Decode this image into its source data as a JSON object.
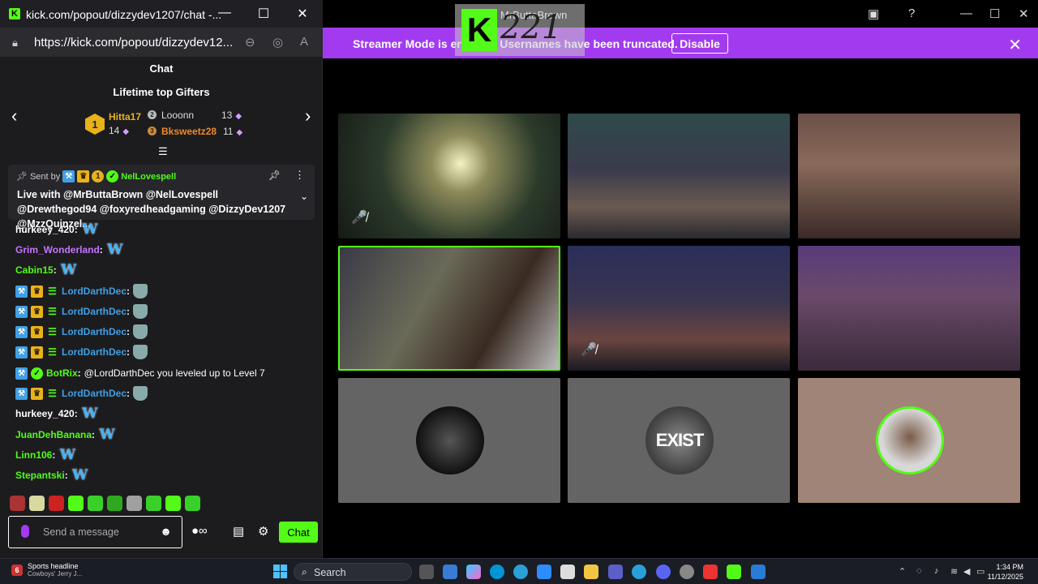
{
  "window": {
    "title": "kick.com/popout/dizzydev1207/chat -...",
    "url": "https://kick.com/popout/dizzydev12..."
  },
  "chat": {
    "header": "Chat",
    "gifters": {
      "title": "Lifetime top Gifters",
      "entries": [
        {
          "rank": "1",
          "name": "Hitta17",
          "count": "14"
        },
        {
          "rank": "2",
          "name": "Looonn",
          "count": "13"
        },
        {
          "rank": "3",
          "name": "Bksweetz28",
          "count": "11"
        }
      ]
    },
    "pinned": {
      "sent_by": "Sent by",
      "badge_number": "1",
      "sender": "NelLovespell",
      "text": "Live with @MrButtaBrown @NelLovespell @Drewthegod94 @foxyredheadgaming @DizzyDev1207 @MzzQuinzel..."
    },
    "messages": [
      {
        "user": "hurkeey_420",
        "color": "#ffffff",
        "text": ""
      },
      {
        "user": "Grim_Wonderland",
        "color": "#c674ff",
        "text": ""
      },
      {
        "user": "Cabin15",
        "color": "#53fc18",
        "text": ""
      },
      {
        "user": "LordDarthDec",
        "color": "#3fa0e6",
        "text": ""
      },
      {
        "user": "LordDarthDec",
        "color": "#3fa0e6",
        "text": ""
      },
      {
        "user": "LordDarthDec",
        "color": "#3fa0e6",
        "text": ""
      },
      {
        "user": "LordDarthDec",
        "color": "#3fa0e6",
        "text": ""
      },
      {
        "user": "BotRix",
        "color": "#53fc18",
        "text": "@LordDarthDec you leveled up to Level 7"
      },
      {
        "user": "LordDarthDec",
        "color": "#3fa0e6",
        "text": ""
      },
      {
        "user": "hurkeey_420",
        "color": "#ffffff",
        "text": ""
      },
      {
        "user": "JuanDehBanana",
        "color": "#53fc18",
        "text": ""
      },
      {
        "user": "Linn106",
        "color": "#53fc18",
        "text": ""
      },
      {
        "user": "Stepantski",
        "color": "#53fc18",
        "text": ""
      }
    ],
    "input_placeholder": "Send a message",
    "send_label": "Chat"
  },
  "stage": {
    "banner_text": "Streamer Mode is enabled. Usernames have been truncated.",
    "disable_label": "Disable",
    "logo_number": "221",
    "logo_name": "MrButtaBrown",
    "exist_text": "EXIST"
  },
  "taskbar": {
    "news_badge": "6",
    "news_title": "Sports headline",
    "news_sub": "Cowboys' Jerry J...",
    "search_label": "Search",
    "time": "1:34 PM",
    "date": "11/12/2025"
  },
  "colors": {
    "kick_green": "#53fc18",
    "banner_purple": "#a23bf0",
    "chat_bg": "#1c1c1f",
    "mod_blue": "#3fa0e6"
  }
}
